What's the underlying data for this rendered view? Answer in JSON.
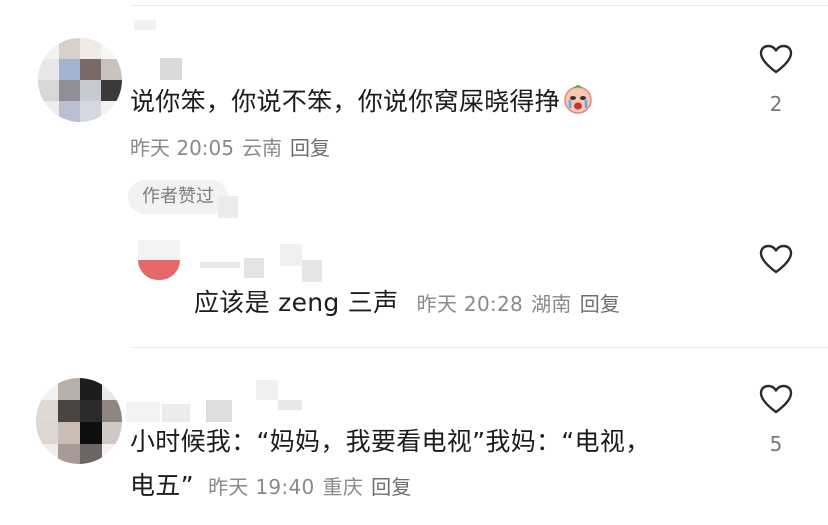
{
  "comments": [
    {
      "text": "说你笨，你说不笨，你说你窝屎晓得挣",
      "emoji": "crying-face-emoji",
      "meta": {
        "time": "昨天 20:05",
        "location": "云南",
        "reply": "回复"
      },
      "badge": "作者赞过",
      "likes": "2"
    },
    {
      "text": "应该是 zeng 三声",
      "meta": {
        "time": "昨天 20:28",
        "location": "湖南",
        "reply": "回复"
      },
      "likes": ""
    },
    {
      "text_line1": "小时候我：“妈妈，我要看电视”我妈：“电视，",
      "text_line2": "电五”",
      "meta": {
        "time": "昨天 19:40",
        "location": "重庆",
        "reply": "回复"
      },
      "likes": "5"
    }
  ],
  "colors": {
    "heart_outline": "#2b2b2b",
    "meta_text": "#8a8a8a",
    "badge_bg": "#f2f2f2"
  }
}
